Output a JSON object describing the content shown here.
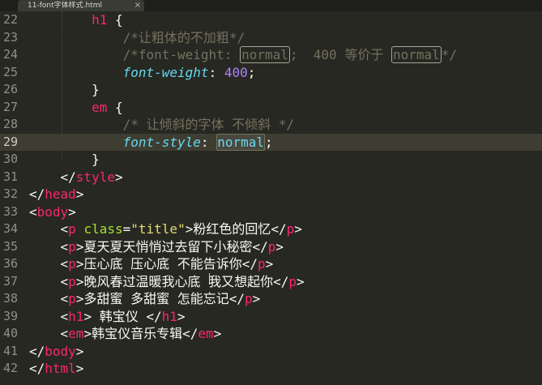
{
  "tab": {
    "title": "11-font字体样式.html",
    "close": "×"
  },
  "lines": [
    {
      "num": "22",
      "parts": [
        [
          "indent",
          "        "
        ],
        [
          "tag",
          "h1"
        ],
        [
          "punct",
          " {"
        ]
      ]
    },
    {
      "num": "23",
      "parts": [
        [
          "indent",
          "            "
        ],
        [
          "cmt",
          "/*让粗体的不加粗*/"
        ]
      ]
    },
    {
      "num": "24",
      "parts": [
        [
          "indent",
          "            "
        ],
        [
          "cmt",
          "/*font-weight: "
        ],
        [
          "box",
          "normal"
        ],
        [
          "cmt",
          ";  400 等价于 "
        ],
        [
          "box",
          "normal"
        ],
        [
          "cmt",
          "*/"
        ]
      ]
    },
    {
      "num": "25",
      "parts": [
        [
          "indent",
          "            "
        ],
        [
          "prop",
          "font-weight"
        ],
        [
          "punct",
          ": "
        ],
        [
          "num",
          "400"
        ],
        [
          "punct",
          ";"
        ]
      ]
    },
    {
      "num": "26",
      "parts": [
        [
          "indent",
          "        "
        ],
        [
          "punct",
          "}"
        ]
      ]
    },
    {
      "num": "27",
      "parts": [
        [
          "indent",
          "        "
        ],
        [
          "tag",
          "em"
        ],
        [
          "punct",
          " {"
        ]
      ]
    },
    {
      "num": "28",
      "parts": [
        [
          "indent",
          "            "
        ],
        [
          "cmt",
          "/* 让倾斜的字体 不倾斜 */"
        ]
      ]
    },
    {
      "num": "29",
      "current": true,
      "parts": [
        [
          "indent",
          "            "
        ],
        [
          "prop",
          "font-style"
        ],
        [
          "punct",
          ": "
        ],
        [
          "sel",
          "normal"
        ],
        [
          "punct",
          ";"
        ]
      ]
    },
    {
      "num": "30",
      "parts": [
        [
          "indent",
          "        "
        ],
        [
          "punct",
          "}"
        ]
      ]
    },
    {
      "num": "31",
      "parts": [
        [
          "indent",
          "    "
        ],
        [
          "punct",
          "</"
        ],
        [
          "tag",
          "style"
        ],
        [
          "punct",
          ">"
        ]
      ]
    },
    {
      "num": "32",
      "parts": [
        [
          "punct",
          "</"
        ],
        [
          "tag",
          "head"
        ],
        [
          "punct",
          ">"
        ]
      ]
    },
    {
      "num": "33",
      "parts": [
        [
          "punct",
          "<"
        ],
        [
          "tag",
          "body"
        ],
        [
          "punct",
          ">"
        ]
      ]
    },
    {
      "num": "34",
      "parts": [
        [
          "indent",
          "    "
        ],
        [
          "punct",
          "<"
        ],
        [
          "tag",
          "p"
        ],
        [
          "punct",
          " "
        ],
        [
          "attr",
          "class"
        ],
        [
          "punct",
          "="
        ],
        [
          "str",
          "\"title\""
        ],
        [
          "punct",
          ">"
        ],
        [
          "txt",
          "粉红色的回忆"
        ],
        [
          "punct",
          "</"
        ],
        [
          "tag",
          "p"
        ],
        [
          "punct",
          ">"
        ]
      ]
    },
    {
      "num": "35",
      "parts": [
        [
          "indent",
          "    "
        ],
        [
          "punct",
          "<"
        ],
        [
          "tag",
          "p"
        ],
        [
          "punct",
          ">"
        ],
        [
          "txt",
          "夏天夏天悄悄过去留下小秘密"
        ],
        [
          "punct",
          "</"
        ],
        [
          "tag",
          "p"
        ],
        [
          "punct",
          ">"
        ]
      ]
    },
    {
      "num": "36",
      "parts": [
        [
          "indent",
          "    "
        ],
        [
          "punct",
          "<"
        ],
        [
          "tag",
          "p"
        ],
        [
          "punct",
          ">"
        ],
        [
          "txt",
          "压心底 压心底 不能告诉你"
        ],
        [
          "punct",
          "</"
        ],
        [
          "tag",
          "p"
        ],
        [
          "punct",
          ">"
        ]
      ]
    },
    {
      "num": "37",
      "parts": [
        [
          "indent",
          "    "
        ],
        [
          "punct",
          "<"
        ],
        [
          "tag",
          "p"
        ],
        [
          "punct",
          ">"
        ],
        [
          "txt",
          "晚风春过温暖我心底 我又想起你"
        ],
        [
          "punct",
          "</"
        ],
        [
          "tag",
          "p"
        ],
        [
          "punct",
          ">"
        ]
      ]
    },
    {
      "num": "38",
      "parts": [
        [
          "indent",
          "    "
        ],
        [
          "punct",
          "<"
        ],
        [
          "tag",
          "p"
        ],
        [
          "punct",
          ">"
        ],
        [
          "txt",
          "多甜蜜 多甜蜜 怎能忘记"
        ],
        [
          "punct",
          "</"
        ],
        [
          "tag",
          "p"
        ],
        [
          "punct",
          ">"
        ]
      ]
    },
    {
      "num": "39",
      "parts": [
        [
          "indent",
          "    "
        ],
        [
          "punct",
          "<"
        ],
        [
          "tag",
          "h1"
        ],
        [
          "punct",
          ">"
        ],
        [
          "txt",
          " 韩宝仪 "
        ],
        [
          "punct",
          "</"
        ],
        [
          "tag",
          "h1"
        ],
        [
          "punct",
          ">"
        ]
      ]
    },
    {
      "num": "40",
      "parts": [
        [
          "indent",
          "    "
        ],
        [
          "punct",
          "<"
        ],
        [
          "tag",
          "em"
        ],
        [
          "punct",
          ">"
        ],
        [
          "txt",
          "韩宝仪音乐专辑"
        ],
        [
          "punct",
          "</"
        ],
        [
          "tag",
          "em"
        ],
        [
          "punct",
          ">"
        ]
      ]
    },
    {
      "num": "41",
      "parts": [
        [
          "punct",
          "</"
        ],
        [
          "tag",
          "body"
        ],
        [
          "punct",
          ">"
        ]
      ]
    },
    {
      "num": "42",
      "parts": [
        [
          "punct",
          "</"
        ],
        [
          "tag",
          "html"
        ],
        [
          "punct",
          ">"
        ]
      ]
    }
  ],
  "colors": {
    "background": "#272822",
    "tag": "#f92672",
    "attribute": "#a6e22e",
    "string": "#e6db74",
    "comment": "#75715e",
    "property": "#66d9ef",
    "number": "#ae81ff"
  }
}
